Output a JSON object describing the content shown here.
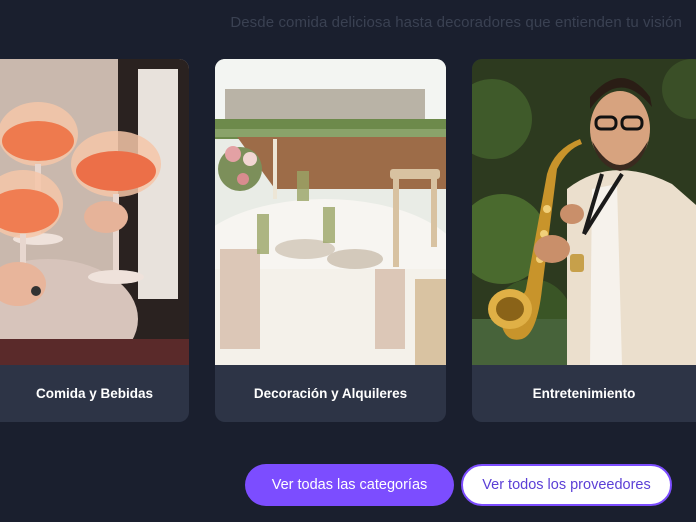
{
  "subtitle": "Desde comida deliciosa hasta decoradores que entienden tu visión",
  "cards": [
    {
      "label": "Comida y Bebidas"
    },
    {
      "label": "Decoración y Alquileres"
    },
    {
      "label": "Entretenimiento"
    }
  ],
  "buttons": {
    "all_categories": "Ver todas las categorías",
    "all_providers": "Ver todos los proveedores"
  },
  "colors": {
    "background": "#1a1f2e",
    "card": "#2d3446",
    "accent": "#7c4dff"
  }
}
